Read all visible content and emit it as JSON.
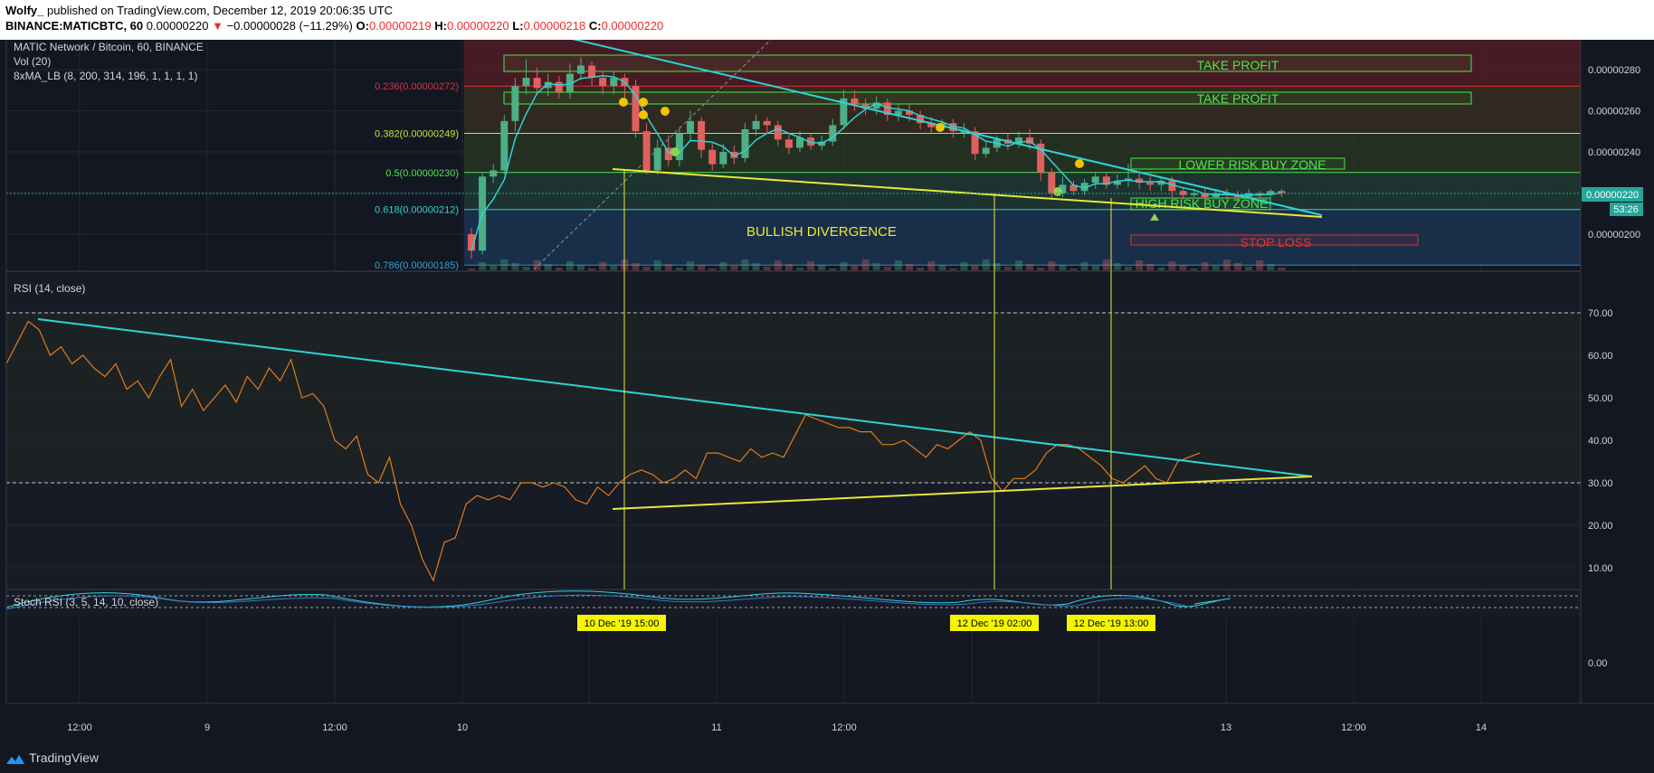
{
  "header": {
    "author": "Wolfy_",
    "published": "published on TradingView.com, December 12, 2019 20:06:35 UTC",
    "symbol": "BINANCE:MATICBTC, 60",
    "last": "0.00000220",
    "change_arrow": "▼",
    "change": "−0.00000028 (−11.29%)",
    "o_label": "O:",
    "o": "0.00000219",
    "h_label": "H:",
    "h": "0.00000220",
    "l_label": "L:",
    "l": "0.00000218",
    "c_label": "C:",
    "c": "0.00000220"
  },
  "legend": {
    "title": "MATIC Network / Bitcoin, 60, BINANCE",
    "vol": "Vol (20)",
    "ma": "8xMA_LB (8, 200, 314, 196, 1, 1, 1, 1)",
    "rsi": "RSI (14, close)",
    "stoch": "Stoch RSI (3, 5, 14, 10, close)"
  },
  "footer": {
    "brand": "TradingView"
  },
  "colors": {
    "bg": "#131722",
    "up": "#4caf85",
    "down": "#e06060",
    "trend": "#2ed3d6",
    "support": "#e8e83a",
    "rsi_line": "#e07b1f",
    "zone_green": "#4be64b",
    "zone_red": "#e03232",
    "marker": "#f0c200"
  },
  "chart_data": [
    {
      "type": "candlestick",
      "title": "MATIC Network / Bitcoin, 60, BINANCE",
      "x_ticks": [
        "12:00",
        "9",
        "12:00",
        "10",
        "11",
        "12:00",
        "13",
        "12:00",
        "14"
      ],
      "y_ticks": [
        "0.00000280",
        "0.00000260",
        "0.00000240",
        "0.00000220",
        "0.00000200"
      ],
      "ylim": [
        1.85e-06,
        2.96e-06
      ],
      "last_price": "0.00000220",
      "countdown": "53:26",
      "fib_levels": [
        {
          "label": "0.236(0.00000272)",
          "value": 2.72e-06
        },
        {
          "label": "0.382(0.00000249)",
          "value": 2.49e-06
        },
        {
          "label": "0.5(0.00000230)",
          "value": 2.3e-06
        },
        {
          "label": "0.618(0.00000212)",
          "value": 2.12e-06
        },
        {
          "label": "0.786(0.00000185)",
          "value": 1.85e-06
        }
      ],
      "zones": [
        {
          "label": "TAKE PROFIT"
        },
        {
          "label": "TAKE PROFIT"
        },
        {
          "label": "LOWER RISK BUY ZONE"
        },
        {
          "label": "HIGH RISK BUY ZONE"
        },
        {
          "label": "STOP LOSS"
        }
      ],
      "annotation": "BULLISH DIVERGENCE",
      "candles": [
        [
          2e-06,
          1.92e-06,
          2.03e-06,
          1.88e-06
        ],
        [
          1.92e-06,
          2.28e-06,
          2.3e-06,
          1.9e-06
        ],
        [
          2.28e-06,
          2.31e-06,
          2.34e-06,
          2.25e-06
        ],
        [
          2.31e-06,
          2.55e-06,
          2.58e-06,
          2.29e-06
        ],
        [
          2.55e-06,
          2.72e-06,
          2.76e-06,
          2.5e-06
        ],
        [
          2.72e-06,
          2.76e-06,
          2.85e-06,
          2.68e-06
        ],
        [
          2.76e-06,
          2.71e-06,
          2.81e-06,
          2.68e-06
        ],
        [
          2.71e-06,
          2.74e-06,
          2.78e-06,
          2.67e-06
        ],
        [
          2.74e-06,
          2.69e-06,
          2.77e-06,
          2.66e-06
        ],
        [
          2.69e-06,
          2.78e-06,
          2.83e-06,
          2.66e-06
        ],
        [
          2.78e-06,
          2.82e-06,
          2.86e-06,
          2.75e-06
        ],
        [
          2.82e-06,
          2.76e-06,
          2.84e-06,
          2.72e-06
        ],
        [
          2.76e-06,
          2.72e-06,
          2.79e-06,
          2.68e-06
        ],
        [
          2.72e-06,
          2.76e-06,
          2.79e-06,
          2.68e-06
        ],
        [
          2.76e-06,
          2.72e-06,
          2.78e-06,
          2.66e-06
        ],
        [
          2.72e-06,
          2.5e-06,
          2.75e-06,
          2.47e-06
        ],
        [
          2.5e-06,
          2.31e-06,
          2.54e-06,
          2.29e-06
        ],
        [
          2.31e-06,
          2.42e-06,
          2.46e-06,
          2.29e-06
        ],
        [
          2.42e-06,
          2.36e-06,
          2.48e-06,
          2.33e-06
        ],
        [
          2.36e-06,
          2.49e-06,
          2.52e-06,
          2.33e-06
        ],
        [
          2.49e-06,
          2.55e-06,
          2.6e-06,
          2.45e-06
        ],
        [
          2.55e-06,
          2.41e-06,
          2.57e-06,
          2.37e-06
        ],
        [
          2.41e-06,
          2.34e-06,
          2.45e-06,
          2.31e-06
        ],
        [
          2.34e-06,
          2.4e-06,
          2.44e-06,
          2.32e-06
        ],
        [
          2.4e-06,
          2.37e-06,
          2.43e-06,
          2.34e-06
        ],
        [
          2.37e-06,
          2.51e-06,
          2.54e-06,
          2.35e-06
        ],
        [
          2.51e-06,
          2.55e-06,
          2.58e-06,
          2.48e-06
        ],
        [
          2.55e-06,
          2.53e-06,
          2.57e-06,
          2.49e-06
        ],
        [
          2.53e-06,
          2.46e-06,
          2.55e-06,
          2.43e-06
        ],
        [
          2.46e-06,
          2.42e-06,
          2.49e-06,
          2.39e-06
        ],
        [
          2.42e-06,
          2.47e-06,
          2.5e-06,
          2.4e-06
        ],
        [
          2.47e-06,
          2.43e-06,
          2.49e-06,
          2.41e-06
        ],
        [
          2.43e-06,
          2.45e-06,
          2.48e-06,
          2.41e-06
        ],
        [
          2.45e-06,
          2.53e-06,
          2.56e-06,
          2.43e-06
        ],
        [
          2.53e-06,
          2.66e-06,
          2.7e-06,
          2.51e-06
        ],
        [
          2.66e-06,
          2.63e-06,
          2.7e-06,
          2.6e-06
        ],
        [
          2.63e-06,
          2.61e-06,
          2.66e-06,
          2.58e-06
        ],
        [
          2.61e-06,
          2.64e-06,
          2.67e-06,
          2.58e-06
        ],
        [
          2.64e-06,
          2.58e-06,
          2.66e-06,
          2.55e-06
        ],
        [
          2.58e-06,
          2.6e-06,
          2.63e-06,
          2.55e-06
        ],
        [
          2.6e-06,
          2.58e-06,
          2.63e-06,
          2.55e-06
        ],
        [
          2.58e-06,
          2.54e-06,
          2.6e-06,
          2.51e-06
        ],
        [
          2.54e-06,
          2.52e-06,
          2.57e-06,
          2.49e-06
        ],
        [
          2.52e-06,
          2.54e-06,
          2.56e-06,
          2.5e-06
        ],
        [
          2.54e-06,
          2.5e-06,
          2.56e-06,
          2.47e-06
        ],
        [
          2.5e-06,
          2.5e-06,
          2.54e-06,
          2.47e-06
        ],
        [
          2.5e-06,
          2.39e-06,
          2.52e-06,
          2.36e-06
        ],
        [
          2.39e-06,
          2.42e-06,
          2.45e-06,
          2.37e-06
        ],
        [
          2.42e-06,
          2.46e-06,
          2.48e-06,
          2.4e-06
        ],
        [
          2.46e-06,
          2.44e-06,
          2.49e-06,
          2.41e-06
        ],
        [
          2.44e-06,
          2.47e-06,
          2.5e-06,
          2.42e-06
        ],
        [
          2.47e-06,
          2.44e-06,
          2.51e-06,
          2.41e-06
        ],
        [
          2.44e-06,
          2.3e-06,
          2.46e-06,
          2.26e-06
        ],
        [
          2.3e-06,
          2.2e-06,
          2.32e-06,
          2.17e-06
        ],
        [
          2.2e-06,
          2.24e-06,
          2.28e-06,
          2.18e-06
        ],
        [
          2.24e-06,
          2.21e-06,
          2.26e-06,
          2.19e-06
        ],
        [
          2.21e-06,
          2.25e-06,
          2.27e-06,
          2.19e-06
        ],
        [
          2.25e-06,
          2.28e-06,
          2.3e-06,
          2.22e-06
        ],
        [
          2.28e-06,
          2.24e-06,
          2.3e-06,
          2.22e-06
        ],
        [
          2.24e-06,
          2.26e-06,
          2.29e-06,
          2.22e-06
        ],
        [
          2.26e-06,
          2.27e-06,
          2.34e-06,
          2.23e-06
        ],
        [
          2.27e-06,
          2.25e-06,
          2.3e-06,
          2.22e-06
        ],
        [
          2.25e-06,
          2.24e-06,
          2.28e-06,
          2.21e-06
        ],
        [
          2.24e-06,
          2.26e-06,
          2.28e-06,
          2.21e-06
        ],
        [
          2.26e-06,
          2.21e-06,
          2.28e-06,
          2.18e-06
        ],
        [
          2.21e-06,
          2.19e-06,
          2.23e-06,
          2.17e-06
        ],
        [
          2.19e-06,
          2.2e-06,
          2.22e-06,
          2.18e-06
        ],
        [
          2.2e-06,
          2.18e-06,
          2.22e-06,
          2.16e-06
        ],
        [
          2.18e-06,
          2.2e-06,
          2.22e-06,
          2.17e-06
        ],
        [
          2.2e-06,
          2.19e-06,
          2.22e-06,
          2.17e-06
        ],
        [
          2.19e-06,
          2.18e-06,
          2.21e-06,
          2.16e-06
        ],
        [
          2.18e-06,
          2.2e-06,
          2.22e-06,
          2.17e-06
        ],
        [
          2.2e-06,
          2.19e-06,
          2.21e-06,
          2.17e-06
        ],
        [
          2.19e-06,
          2.21e-06,
          2.22e-06,
          2.18e-06
        ],
        [
          2.21e-06,
          2.2e-06,
          2.22e-06,
          2.18e-06
        ]
      ],
      "candle_fields": [
        "open",
        "close",
        "high",
        "low"
      ]
    },
    {
      "type": "line",
      "title": "RSI (14, close)",
      "y_ticks": [
        "70.00",
        "60.00",
        "50.00",
        "40.00",
        "30.00",
        "20.00",
        "10.00"
      ],
      "ylim": [
        5,
        76
      ],
      "values": [
        58,
        63,
        68,
        66,
        60,
        62,
        58,
        60,
        57,
        55,
        58,
        52,
        54,
        50,
        55,
        59,
        48,
        52,
        47,
        50,
        53,
        49,
        55,
        52,
        57,
        54,
        59,
        50,
        51,
        48,
        40,
        38,
        41,
        32,
        30,
        36,
        25,
        20,
        12,
        7,
        16,
        17,
        25,
        27,
        26,
        27,
        26,
        30,
        30,
        29,
        30,
        29,
        26,
        25,
        29,
        27,
        30,
        32,
        33,
        32,
        30,
        31,
        33,
        31,
        37,
        37,
        36,
        35,
        38,
        36,
        37,
        36,
        41,
        46,
        45,
        44,
        43,
        43,
        42,
        42,
        39,
        39,
        40,
        38,
        36,
        39,
        38,
        40,
        42,
        40,
        31,
        28,
        31,
        31,
        33,
        37,
        39,
        39,
        38,
        36,
        34,
        31,
        30,
        32,
        34,
        31,
        30,
        35,
        36,
        37
      ],
      "levels": [
        70,
        30
      ]
    },
    {
      "type": "line",
      "title": "Stoch RSI (3, 5, 14, 10, close)",
      "y_ticks": [
        "0.00"
      ],
      "series_count": 2
    }
  ],
  "time_labels": [
    "10 Dec '19   15:00",
    "12 Dec '19   02:00",
    "12 Dec '19   13:00"
  ]
}
